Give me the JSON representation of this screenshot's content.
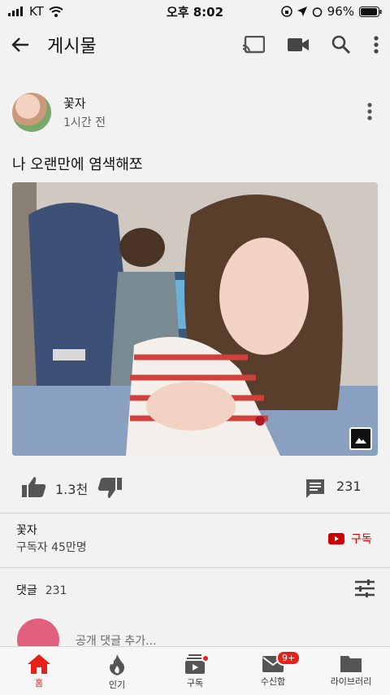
{
  "status": {
    "carrier": "KT",
    "time": "오후 8:02",
    "battery": "96%"
  },
  "header": {
    "title": "게시물"
  },
  "post": {
    "channel": "꽃자",
    "time": "1시간 전",
    "text": "나 오랜만에 염색해쪼",
    "likes": "1.3천",
    "comments": "231"
  },
  "channel": {
    "name": "꽃자",
    "subscribers": "구독자 45만명",
    "subscribe_label": "구독"
  },
  "comments_section": {
    "label": "댓글",
    "count": "231",
    "add_placeholder": "공개 댓글 추가..."
  },
  "bottom_nav": [
    {
      "label": "홈",
      "icon": "home-icon"
    },
    {
      "label": "인기",
      "icon": "trending-icon"
    },
    {
      "label": "구독",
      "icon": "subscriptions-icon"
    },
    {
      "label": "수신함",
      "icon": "inbox-icon",
      "badge": "9+"
    },
    {
      "label": "라이브러리",
      "icon": "library-icon"
    }
  ],
  "colors": {
    "accent": "#e62117",
    "subscribe": "#cc0000"
  }
}
